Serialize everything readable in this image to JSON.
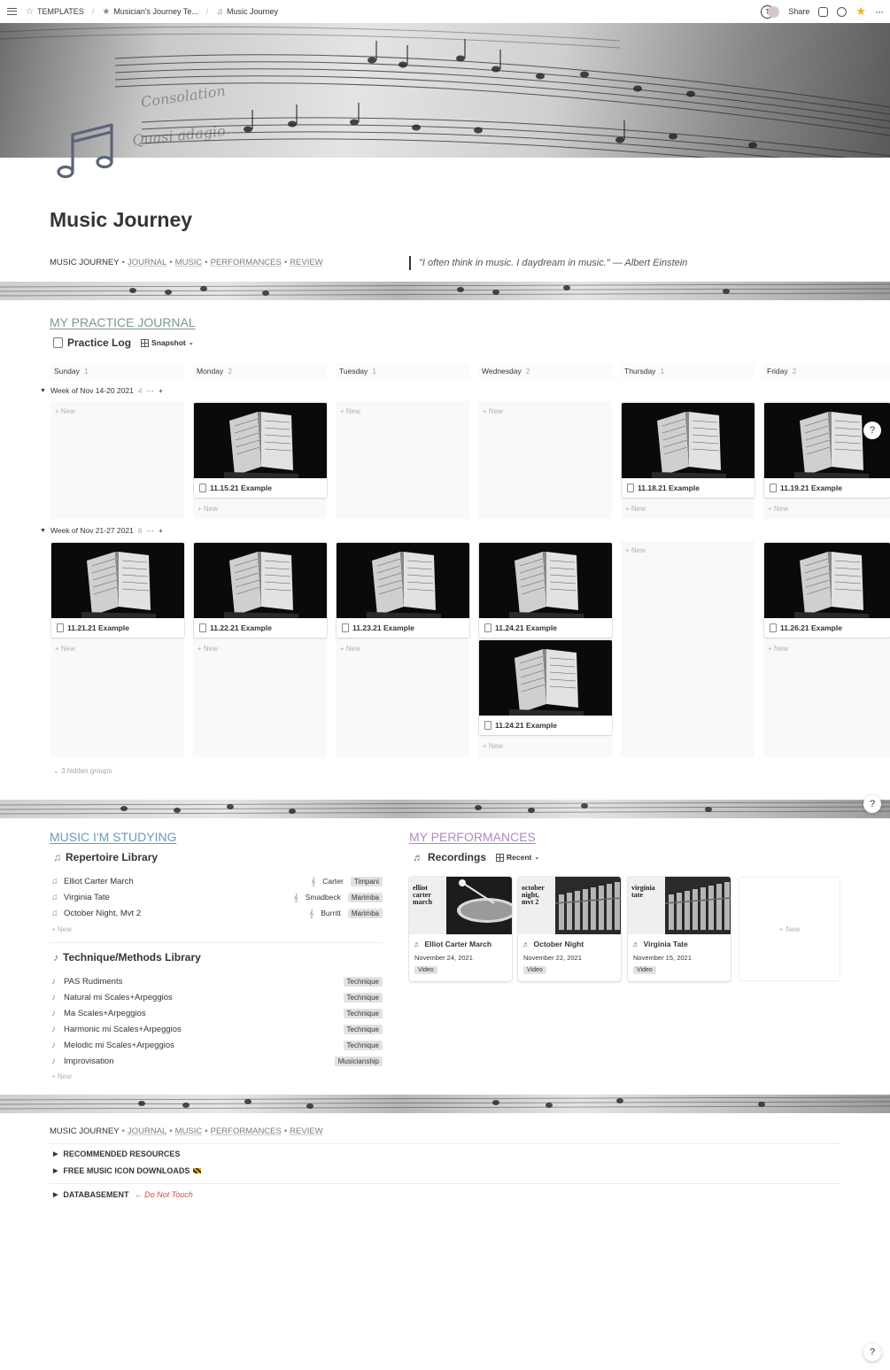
{
  "breadcrumbs": [
    "TEMPLATES",
    "Musician's Journey Te...",
    "Music Journey"
  ],
  "topbar": {
    "avatar_letter": "T",
    "share_label": "Share"
  },
  "page": {
    "title": "Music Journey",
    "quote": "\"I often think in music. I daydream in music.\" — Albert Einstein"
  },
  "nav": {
    "current": "MUSIC JOURNEY",
    "links": [
      "JOURNAL",
      "MUSIC",
      "PERFORMANCES",
      "REVIEW"
    ],
    "separator": "•"
  },
  "journal": {
    "section_title": "MY PRACTICE JOURNAL",
    "db_title": "Practice Log",
    "view_label": "Snapshot",
    "columns": [
      {
        "name": "Sunday",
        "count": "1"
      },
      {
        "name": "Monday",
        "count": "2"
      },
      {
        "name": "Tuesday",
        "count": "1"
      },
      {
        "name": "Wednesday",
        "count": "2"
      },
      {
        "name": "Thursday",
        "count": "1"
      },
      {
        "name": "Friday",
        "count": "2"
      }
    ],
    "groups": [
      {
        "label": "Week of Nov 14-20 2021",
        "count": "4",
        "more": "···",
        "add": "+",
        "cards": [
          "",
          "11.15.21 Example",
          "",
          "",
          "11.18.21 Example",
          "11.19.21 Example"
        ]
      },
      {
        "label": "Week of Nov 21-27 2021",
        "count": "6",
        "more": "···",
        "add": "+",
        "cards": [
          "11.21.21 Example",
          "11.22.21 Example",
          "11.23.21 Example",
          "11.24.21 Example",
          "",
          "11.26.21 Example"
        ],
        "extra_card": "11.24.21 Example"
      }
    ],
    "new_label": "New",
    "hidden_groups": "3 hidden groups"
  },
  "studying": {
    "section_title": "MUSIC I'M STUDYING",
    "repertoire": {
      "title": "Repertoire Library",
      "rows": [
        {
          "name": "Elliot Carter March",
          "composer": "Carter",
          "tag": "Timpani"
        },
        {
          "name": "Virginia Tate",
          "composer": "Smadbeck",
          "tag": "Marimba"
        },
        {
          "name": "October Night, Mvt 2",
          "composer": "Burritt",
          "tag": "Marimba"
        }
      ]
    },
    "technique": {
      "title": "Technique/Methods Library",
      "rows": [
        {
          "name": "PAS Rudiments",
          "tag": "Technique"
        },
        {
          "name": "Natural mi Scales+Arpeggios",
          "tag": "Technique"
        },
        {
          "name": "Ma Scales+Arpeggios",
          "tag": "Technique"
        },
        {
          "name": "Harmonic mi Scales+Arpeggios",
          "tag": "Technique"
        },
        {
          "name": "Melodic mi Scales+Arpeggios",
          "tag": "Technique"
        },
        {
          "name": "Improvisation",
          "tag": "Musicianship"
        }
      ]
    },
    "new_label": "New"
  },
  "performances": {
    "section_title": "MY PERFORMANCES",
    "db_title": "Recordings",
    "view_label": "Recent",
    "cards": [
      {
        "title": "Elliot Carter March",
        "date": "November 24, 2021",
        "tag": "Video",
        "poster": "elliot carter march"
      },
      {
        "title": "October Night",
        "date": "November 22, 2021",
        "tag": "Video",
        "poster": "october night, mvt 2"
      },
      {
        "title": "Virginia Tate",
        "date": "November 15, 2021",
        "tag": "Video",
        "poster": "virginia tate"
      }
    ],
    "new_label": "New"
  },
  "footer": {
    "toggles": [
      {
        "label": "RECOMMENDED RESOURCES",
        "suffix": ""
      },
      {
        "label": "FREE MUSIC ICON DOWNLOADS",
        "suffix": ""
      },
      {
        "label": "DATABASEMENT",
        "suffix": "← Do Not Touch"
      }
    ]
  },
  "help_label": "?",
  "colors": {
    "journal_accent": "#7b9b87",
    "studying_accent": "#6b9ab8",
    "performances_accent": "#b089c4",
    "warning": "#d44c47",
    "favorite": "#f2b619"
  },
  "icons": [
    "menu-icon",
    "star-icon",
    "music-note-icon",
    "comment-icon",
    "clock-icon",
    "favorite-star-icon",
    "page-icon",
    "table-icon",
    "chevron-down-icon"
  ]
}
